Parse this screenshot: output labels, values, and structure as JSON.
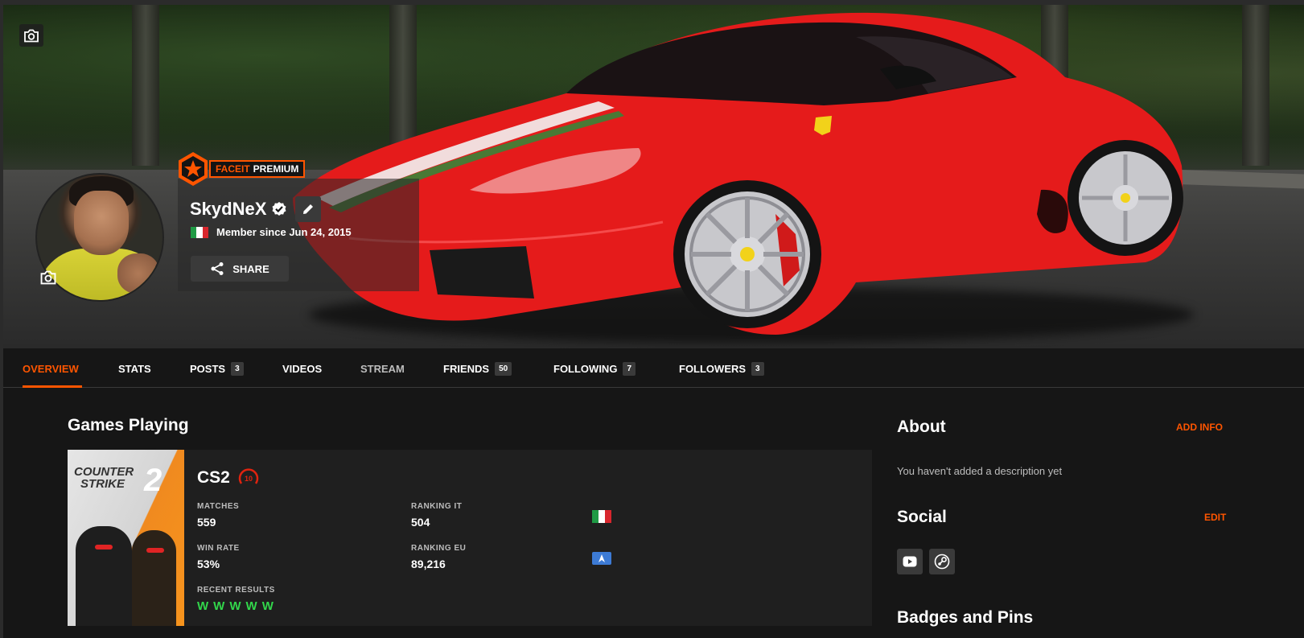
{
  "profile": {
    "premium_brand": "FACEIT",
    "premium_label": "PREMIUM",
    "username": "SkydNeX",
    "member_since": "Member since Jun 24, 2015",
    "share_label": "SHARE"
  },
  "tabs": [
    {
      "label": "OVERVIEW"
    },
    {
      "label": "STATS"
    },
    {
      "label": "POSTS",
      "count": "3"
    },
    {
      "label": "VIDEOS"
    },
    {
      "label": "STREAM"
    },
    {
      "label": "FRIENDS",
      "count": "50"
    },
    {
      "label": "FOLLOWING",
      "count": "7"
    },
    {
      "label": "FOLLOWERS",
      "count": "3"
    }
  ],
  "games": {
    "title": "Games Playing",
    "cover_line1": "COUNTER",
    "cover_line2": "STRIKE",
    "cover_num": "2",
    "name": "CS2",
    "level": "10",
    "matches_label": "MATCHES",
    "matches_value": "559",
    "winrate_label": "WIN RATE",
    "winrate_value": "53%",
    "ranking_it_label": "RANKING IT",
    "ranking_it_value": "504",
    "ranking_eu_label": "RANKING EU",
    "ranking_eu_value": "89,216",
    "recent_label": "RECENT RESULTS",
    "recent_results": [
      "W",
      "W",
      "W",
      "W",
      "W"
    ]
  },
  "about": {
    "title": "About",
    "action": "ADD INFO",
    "text": "You haven't added a description yet"
  },
  "social": {
    "title": "Social",
    "action": "EDIT",
    "icons": [
      "youtube-icon",
      "steam-icon"
    ]
  },
  "badges": {
    "title": "Badges and Pins"
  },
  "colors": {
    "accent": "#ff5500",
    "win": "#32d74b",
    "background": "#161616",
    "card": "#1f1f1f"
  }
}
